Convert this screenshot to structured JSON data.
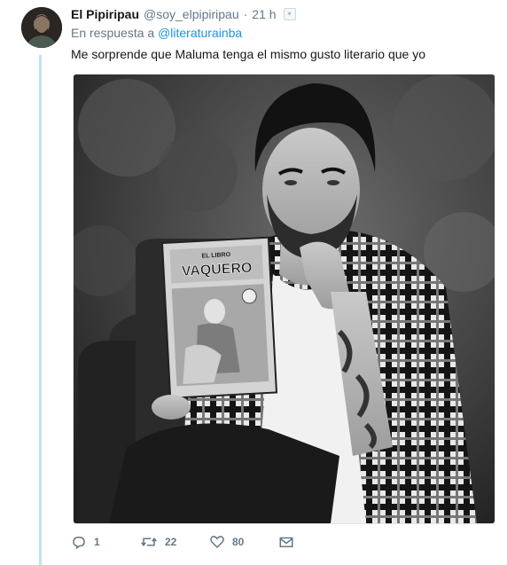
{
  "tweet": {
    "author": {
      "name": "El Pipiripau",
      "handle": "@soy_elpipiripau",
      "avatar_icon": "user-avatar"
    },
    "separator": "·",
    "time": "21 h",
    "reply_prefix": "En respuesta a",
    "reply_to": "@literaturainba",
    "text": "Me sorprende que Maluma tenga el mismo gusto literario que yo",
    "media": {
      "comic_header": "EL LIBRO",
      "comic_title": "VAQUERO"
    },
    "actions": {
      "replies": "1",
      "retweets": "22",
      "likes": "80"
    }
  },
  "colors": {
    "thread_line": "#bfe3f7",
    "link": "#1b95e0",
    "muted": "#657786"
  }
}
